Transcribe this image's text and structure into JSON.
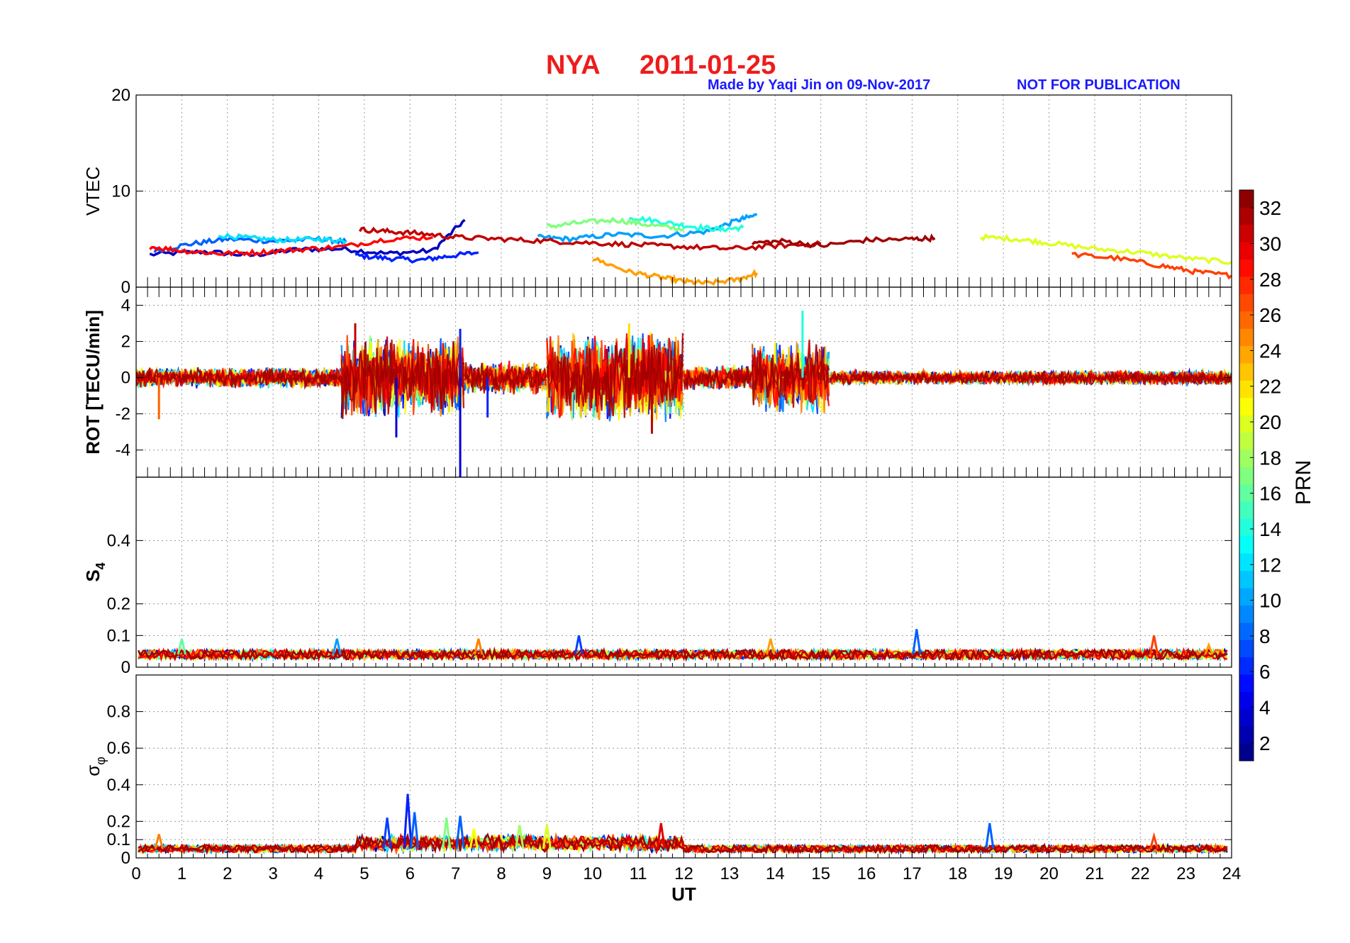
{
  "figure": {
    "title_station": "NYA",
    "title_date": "2011-01-25",
    "credit": "Made by Yaqi Jin on 09-Nov-2017",
    "notice": "NOT FOR PUBLICATION",
    "title_color": "#ee1c1c",
    "credit_color": "#1a1aff"
  },
  "chart_data": [
    {
      "type": "line",
      "panel": "vtec",
      "ylabel": "VTEC",
      "ylim": [
        0,
        20
      ],
      "yticks": [
        0,
        10,
        20
      ],
      "xlim": [
        0,
        24
      ],
      "grid": true,
      "series": [
        {
          "prn": 3,
          "x": [
            0.3,
            1.5,
            2.5,
            3.5,
            4.5,
            5.5,
            6.5,
            7.2
          ],
          "y": [
            3.4,
            3.7,
            3.3,
            3.9,
            4.0,
            3.5,
            3.8,
            7.0
          ]
        },
        {
          "prn": 6,
          "x": [
            4.8,
            5.5,
            6.2,
            6.8,
            7.5
          ],
          "y": [
            3.3,
            3.0,
            2.8,
            3.2,
            3.6
          ]
        },
        {
          "prn": 8,
          "x": [
            0.4,
            1.2,
            2.0,
            3.0,
            4.0,
            4.6
          ],
          "y": [
            3.8,
            4.5,
            5.0,
            4.8,
            5.0,
            4.7
          ]
        },
        {
          "prn": 10,
          "x": [
            8.8,
            9.5,
            10.5,
            11.5,
            12.5,
            13.2,
            13.6
          ],
          "y": [
            5.2,
            5.0,
            5.5,
            5.3,
            5.8,
            7.0,
            7.5
          ]
        },
        {
          "prn": 12,
          "x": [
            1.8,
            2.5,
            3.2,
            4.0,
            4.6
          ],
          "y": [
            5.4,
            5.1,
            4.9,
            5.0,
            4.8
          ]
        },
        {
          "prn": 14,
          "x": [
            10.8,
            11.5,
            12.2,
            12.8,
            13.3
          ],
          "y": [
            7.3,
            6.8,
            6.3,
            6.0,
            6.2
          ]
        },
        {
          "prn": 17,
          "x": [
            9.0,
            9.7,
            10.5,
            11.2,
            12.0
          ],
          "y": [
            6.3,
            6.7,
            7.0,
            6.5,
            6.0
          ]
        },
        {
          "prn": 20,
          "x": [
            18.5,
            19.3,
            20.0,
            21.0,
            22.0,
            23.0,
            24.0
          ],
          "y": [
            5.2,
            5.0,
            4.6,
            4.0,
            3.6,
            3.0,
            2.6
          ]
        },
        {
          "prn": 24,
          "x": [
            10.0,
            10.8,
            11.5,
            12.0,
            12.5,
            13.2,
            13.6
          ],
          "y": [
            3.0,
            1.6,
            1.0,
            0.6,
            0.4,
            0.8,
            1.5
          ]
        },
        {
          "prn": 27,
          "x": [
            20.5,
            21.5,
            22.5,
            23.2,
            24.0
          ],
          "y": [
            3.4,
            3.0,
            2.2,
            1.6,
            1.2
          ]
        },
        {
          "prn": 29,
          "x": [
            0.3,
            1.0,
            1.8,
            2.6,
            3.5,
            4.5,
            5.5,
            6.5
          ],
          "y": [
            4.2,
            3.8,
            3.5,
            3.6,
            3.9,
            4.2,
            5.0,
            5.2
          ]
        },
        {
          "prn": 31,
          "x": [
            4.9,
            5.5,
            6.2,
            7.0,
            8.0,
            9.0,
            10.0,
            11.0,
            12.0,
            13.0,
            14.0,
            15.0
          ],
          "y": [
            6.0,
            5.8,
            5.6,
            5.2,
            5.0,
            4.8,
            4.6,
            4.4,
            4.2,
            4.0,
            4.3,
            4.5
          ]
        },
        {
          "prn": 32,
          "x": [
            13.5,
            14.2,
            15.0,
            16.0,
            17.0,
            17.5
          ],
          "y": [
            4.6,
            4.8,
            4.3,
            4.9,
            5.0,
            5.1
          ]
        }
      ]
    },
    {
      "type": "line",
      "panel": "rot",
      "ylabel": "ROT [TECU/min]",
      "ylim": [
        -5.5,
        5
      ],
      "yticks": [
        -4,
        -2,
        0,
        2,
        4
      ],
      "xlim": [
        0,
        24
      ],
      "grid": true,
      "noise_bursts": [
        {
          "x_start": 0.0,
          "x_end": 4.5,
          "amplitude": 0.5
        },
        {
          "x_start": 4.5,
          "x_end": 7.2,
          "amplitude": 2.0
        },
        {
          "x_start": 7.2,
          "x_end": 9.0,
          "amplitude": 0.8
        },
        {
          "x_start": 9.0,
          "x_end": 12.0,
          "amplitude": 2.2
        },
        {
          "x_start": 12.0,
          "x_end": 13.5,
          "amplitude": 0.6
        },
        {
          "x_start": 13.5,
          "x_end": 15.2,
          "amplitude": 1.8
        },
        {
          "x_start": 15.2,
          "x_end": 24.0,
          "amplitude": 0.35
        }
      ],
      "spikes": [
        {
          "x": 0.5,
          "y": -2.3,
          "prn": 26
        },
        {
          "x": 4.8,
          "y": 3.0,
          "prn": 31
        },
        {
          "x": 5.7,
          "y": -3.3,
          "prn": 4
        },
        {
          "x": 7.1,
          "y": -5.5,
          "prn": 4
        },
        {
          "x": 7.1,
          "y": 2.7,
          "prn": 6
        },
        {
          "x": 7.7,
          "y": -2.2,
          "prn": 6
        },
        {
          "x": 11.3,
          "y": -3.1,
          "prn": 31
        },
        {
          "x": 10.8,
          "y": 3.0,
          "prn": 22
        },
        {
          "x": 14.6,
          "y": 3.7,
          "prn": 14
        }
      ]
    },
    {
      "type": "line",
      "panel": "s4",
      "ylabel": "S4",
      "ylim": [
        0,
        0.6
      ],
      "yticks": [
        0,
        0.1,
        0.2,
        0.4
      ],
      "xlim": [
        0,
        24
      ],
      "grid": true,
      "baseline": 0.04,
      "spikes": [
        {
          "x": 1.0,
          "y": 0.09,
          "prn": 16
        },
        {
          "x": 4.4,
          "y": 0.09,
          "prn": 10
        },
        {
          "x": 7.5,
          "y": 0.09,
          "prn": 25
        },
        {
          "x": 9.7,
          "y": 0.1,
          "prn": 7
        },
        {
          "x": 13.9,
          "y": 0.09,
          "prn": 24
        },
        {
          "x": 17.1,
          "y": 0.12,
          "prn": 8
        },
        {
          "x": 22.3,
          "y": 0.1,
          "prn": 27
        },
        {
          "x": 23.5,
          "y": 0.07,
          "prn": 24
        }
      ]
    },
    {
      "type": "line",
      "panel": "sigma_phi",
      "ylabel": "σφ",
      "ylim": [
        0,
        1
      ],
      "yticks": [
        0,
        0.1,
        0.2,
        0.4,
        0.6,
        0.8
      ],
      "xlim": [
        0,
        24
      ],
      "xticks": [
        0,
        1,
        2,
        3,
        4,
        5,
        6,
        7,
        8,
        9,
        10,
        11,
        12,
        13,
        14,
        15,
        16,
        17,
        18,
        19,
        20,
        21,
        22,
        23,
        24
      ],
      "xlabel": "UT",
      "grid": true,
      "baseline": 0.05,
      "spikes": [
        {
          "x": 0.5,
          "y": 0.13,
          "prn": 25
        },
        {
          "x": 5.5,
          "y": 0.22,
          "prn": 7
        },
        {
          "x": 5.95,
          "y": 0.35,
          "prn": 6
        },
        {
          "x": 6.1,
          "y": 0.25,
          "prn": 8
        },
        {
          "x": 6.8,
          "y": 0.22,
          "prn": 17
        },
        {
          "x": 7.1,
          "y": 0.23,
          "prn": 8
        },
        {
          "x": 7.4,
          "y": 0.16,
          "prn": 21
        },
        {
          "x": 8.4,
          "y": 0.18,
          "prn": 18
        },
        {
          "x": 9.0,
          "y": 0.18,
          "prn": 20
        },
        {
          "x": 11.5,
          "y": 0.19,
          "prn": 30
        },
        {
          "x": 18.7,
          "y": 0.19,
          "prn": 8
        },
        {
          "x": 22.3,
          "y": 0.12,
          "prn": 27
        }
      ]
    }
  ],
  "colorbar": {
    "label": "PRN",
    "ticks": [
      "2",
      "4",
      "6",
      "8",
      "10",
      "12",
      "14",
      "16",
      "18",
      "20",
      "22",
      "24",
      "26",
      "28",
      "30",
      "32"
    ],
    "range": [
      1,
      33
    ],
    "colormap": "jet"
  }
}
